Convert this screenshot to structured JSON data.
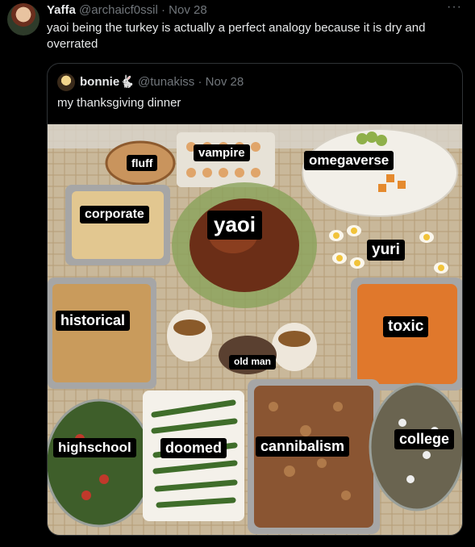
{
  "tweet": {
    "display_name": "Yaffa",
    "handle": "@archaicf0ssil",
    "separator": "·",
    "date": "Nov 28",
    "text": "yaoi being the turkey is actually a perfect analogy because it is dry and overrated",
    "more_icon": "···"
  },
  "quote": {
    "display_name": "bonnie",
    "emoji": "🐇",
    "handle": "@tunakiss",
    "separator": "·",
    "date": "Nov 28",
    "text": "my thanksgiving dinner"
  },
  "labels": {
    "fluff": "fluff",
    "vampire": "vampire",
    "omegaverse": "omegaverse",
    "corporate": "corporate",
    "yaoi": "yaoi",
    "yuri": "yuri",
    "historical": "historical",
    "toxic": "toxic",
    "old_man": "old man",
    "highschool": "highschool",
    "doomed": "doomed",
    "cannibalism": "cannibalism",
    "college": "college"
  }
}
